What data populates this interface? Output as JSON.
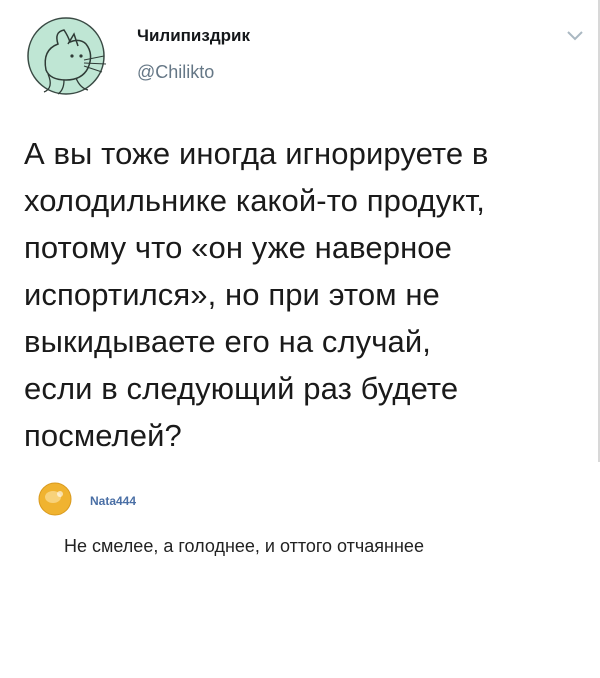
{
  "tweet": {
    "author_name": "Чилипиздрик",
    "author_handle": "@Chilikto",
    "avatar_icon": "green-cat-avatar-icon",
    "menu_icon": "chevron-down-icon",
    "text_lines": [
      "А вы тоже иногда игнорируете в",
      "холодильнике какой-то продукт,",
      "потому что «он уже наверное",
      "испортился», но при этом не",
      "выкидываете его на случай,",
      "если в следующий раз будете",
      "посмелей?"
    ]
  },
  "comment": {
    "avatar_icon": "orange-user-avatar-icon",
    "username": "Nata444",
    "text": "Не смелее, а голоднее, и оттого отчаяннее"
  },
  "colors": {
    "avatar_green": "#bfe6d4",
    "handle_gray": "#657786",
    "reply_avatar_orange": "#f0b330",
    "reply_username_blue": "#4a6fa5"
  }
}
